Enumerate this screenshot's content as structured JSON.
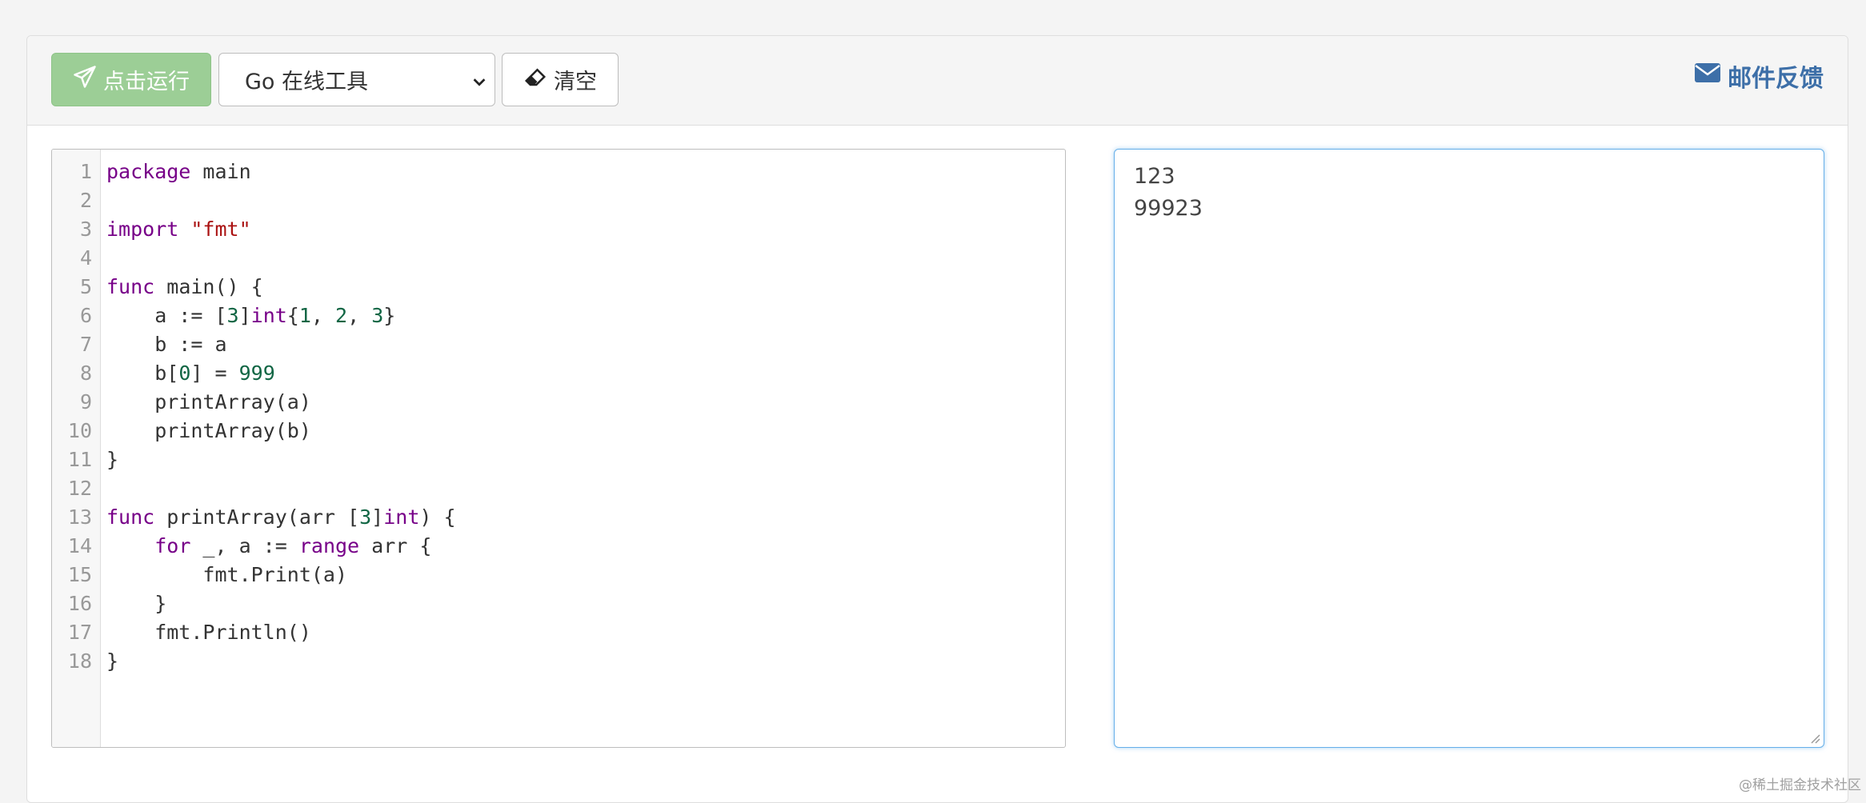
{
  "toolbar": {
    "run_label": "点击运行",
    "language_selected": "Go 在线工具",
    "clear_label": "清空",
    "feedback_label": "邮件反馈"
  },
  "editor": {
    "lines": [
      {
        "num": "1",
        "code": "package main"
      },
      {
        "num": "2",
        "code": ""
      },
      {
        "num": "3",
        "code": "import \"fmt\""
      },
      {
        "num": "4",
        "code": ""
      },
      {
        "num": "5",
        "code": "func main() {"
      },
      {
        "num": "6",
        "code": "    a := [3]int{1, 2, 3}"
      },
      {
        "num": "7",
        "code": "    b := a"
      },
      {
        "num": "8",
        "code": "    b[0] = 999"
      },
      {
        "num": "9",
        "code": "    printArray(a)"
      },
      {
        "num": "10",
        "code": "    printArray(b)"
      },
      {
        "num": "11",
        "code": "}"
      },
      {
        "num": "12",
        "code": ""
      },
      {
        "num": "13",
        "code": "func printArray(arr [3]int) {"
      },
      {
        "num": "14",
        "code": "    for _, a := range arr {"
      },
      {
        "num": "15",
        "code": "        fmt.Print(a)"
      },
      {
        "num": "16",
        "code": "    }"
      },
      {
        "num": "17",
        "code": "    fmt.Println()"
      },
      {
        "num": "18",
        "code": "}"
      }
    ]
  },
  "output": {
    "lines": [
      "123",
      "99923"
    ]
  },
  "watermark": "@稀土掘金技术社区",
  "colors": {
    "run_button": "#9cce96",
    "feedback_link": "#3d6fa8",
    "output_focus_border": "#66afe9",
    "keyword": "#770088",
    "string": "#aa1111",
    "number": "#116644"
  },
  "icons": {
    "run": "paper-plane-icon",
    "clear": "eraser-icon",
    "feedback": "envelope-icon",
    "select": "chevron-down-icon"
  }
}
